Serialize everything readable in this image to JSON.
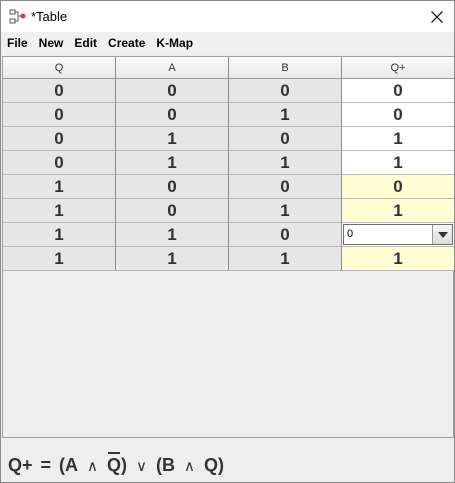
{
  "window": {
    "title": "*Table"
  },
  "menu": [
    "File",
    "New",
    "Edit",
    "Create",
    "K-Map"
  ],
  "table": {
    "columns": [
      "Q",
      "A",
      "B",
      "Q+"
    ],
    "rows": [
      {
        "cells": [
          "0",
          "0",
          "0",
          "0"
        ],
        "output_state": "white"
      },
      {
        "cells": [
          "0",
          "0",
          "1",
          "0"
        ],
        "output_state": "white"
      },
      {
        "cells": [
          "0",
          "1",
          "0",
          "1"
        ],
        "output_state": "white"
      },
      {
        "cells": [
          "0",
          "1",
          "1",
          "1"
        ],
        "output_state": "white"
      },
      {
        "cells": [
          "1",
          "0",
          "0",
          "0"
        ],
        "output_state": "yellow"
      },
      {
        "cells": [
          "1",
          "0",
          "1",
          "1"
        ],
        "output_state": "yellow"
      },
      {
        "cells": [
          "1",
          "1",
          "0",
          "0"
        ],
        "output_state": "editing"
      },
      {
        "cells": [
          "1",
          "1",
          "1",
          "1"
        ],
        "output_state": "yellow"
      }
    ],
    "editor_value": "0"
  },
  "expression": {
    "lhs": "Q+",
    "equals": "=",
    "open1": "(A",
    "and1": "∧",
    "negated_var": "Q",
    "close1": ")",
    "or": "∨",
    "open2": "(B",
    "and2": "∧",
    "var2": "Q)"
  },
  "colors": {
    "input_cell": "#e6e6e6",
    "output_cell": "#ffffff",
    "output_cell_highlight": "#ffffd6"
  }
}
